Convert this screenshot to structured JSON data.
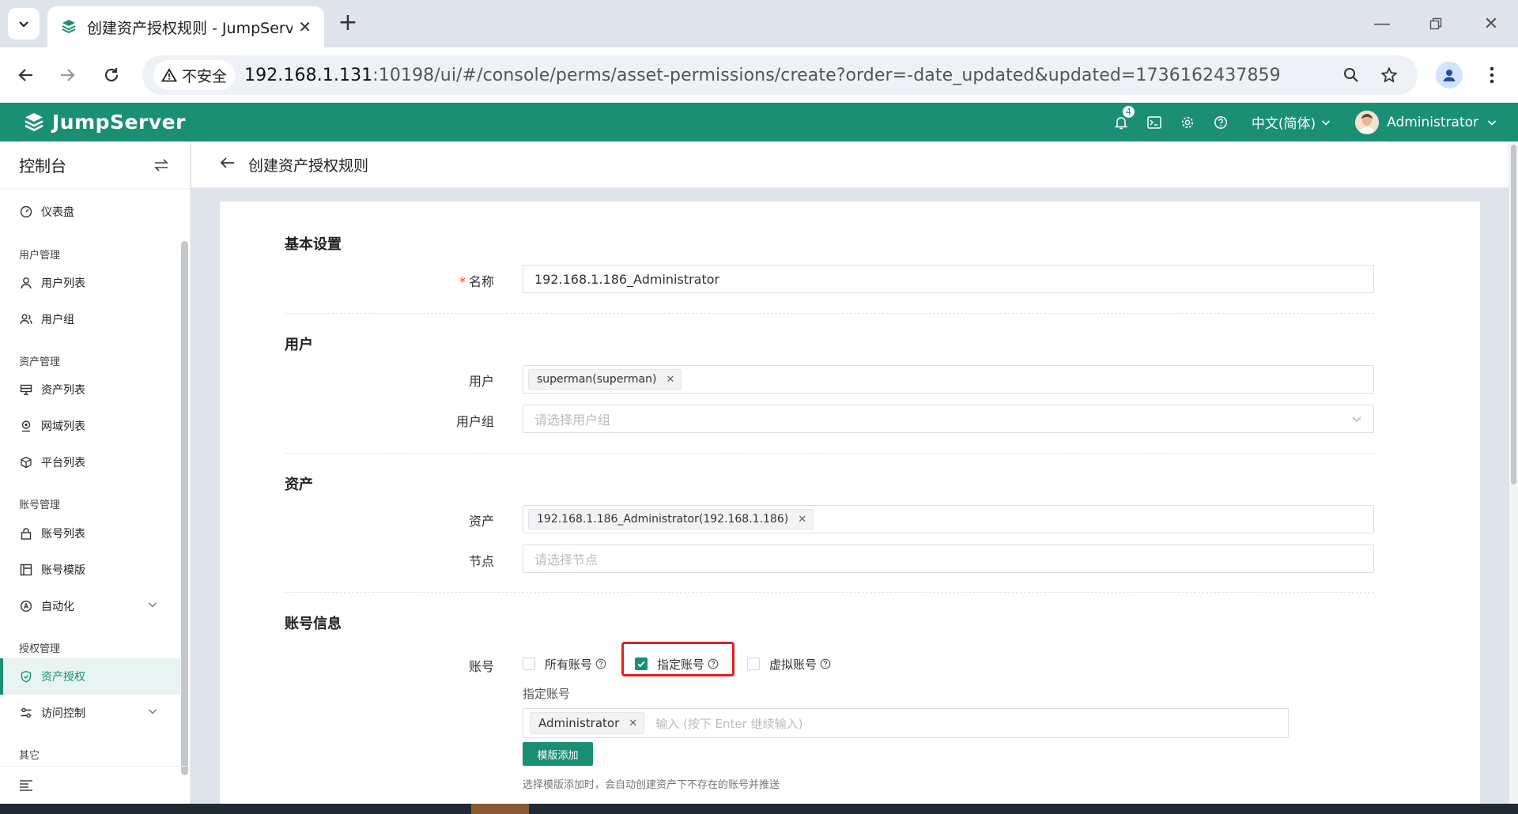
{
  "browser": {
    "tab_title": "创建资产授权规则 - JumpServer",
    "security_label": "不安全",
    "url_host": "192.168.1.131",
    "url_rest": ":10198/ui/#/console/perms/asset-permissions/create?order=-date_updated&updated=1736162437859"
  },
  "header": {
    "logo_text": "JumpServer",
    "notification_count": "4",
    "language": "中文(简体)",
    "username": "Administrator",
    "brand_color": "#1a8f74"
  },
  "sidebar": {
    "title": "控制台",
    "items": {
      "dashboard": "仪表盘",
      "group_users": "用户管理",
      "user_list": "用户列表",
      "user_group": "用户组",
      "group_assets": "资产管理",
      "asset_list": "资产列表",
      "zone_list": "网域列表",
      "platform_list": "平台列表",
      "group_accounts": "账号管理",
      "account_list": "账号列表",
      "account_template": "账号模版",
      "automation": "自动化",
      "group_perms": "授权管理",
      "asset_perms": "资产授权",
      "access_control": "访问控制",
      "group_other": "其它"
    }
  },
  "page": {
    "title": "创建资产授权规则"
  },
  "form": {
    "basic": {
      "section": "基本设置",
      "name_label": "名称",
      "name_value": "192.168.1.186_Administrator"
    },
    "users": {
      "section": "用户",
      "user_label": "用户",
      "user_chip": "superman(superman)",
      "group_label": "用户组",
      "group_placeholder": "请选择用户组"
    },
    "assets": {
      "section": "资产",
      "asset_label": "资产",
      "asset_chip": "192.168.1.186_Administrator(192.168.1.186)",
      "node_label": "节点",
      "node_placeholder": "请选择节点"
    },
    "accounts": {
      "section": "账号信息",
      "account_label": "账号",
      "option_all": "所有账号",
      "option_specified": "指定账号",
      "option_virtual": "虚拟账号",
      "specified_label": "指定账号",
      "account_chip": "Administrator",
      "input_placeholder": "输入 (按下 Enter 继续输入)",
      "template_button": "模版添加",
      "help": "选择模版添加时，会自动创建资产下不存在的账号并推送"
    }
  }
}
